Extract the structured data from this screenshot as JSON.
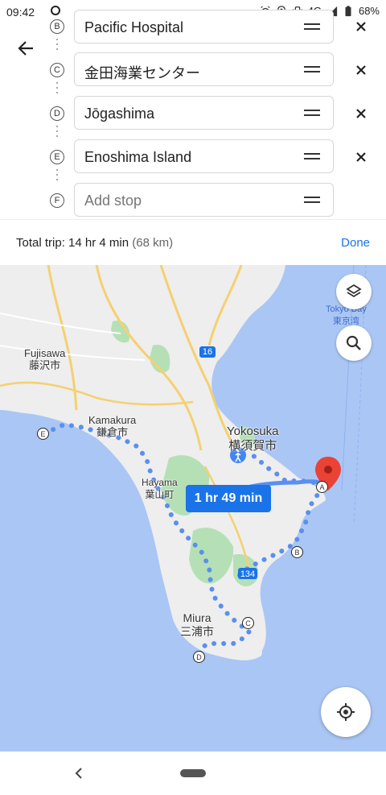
{
  "status_bar": {
    "time": "09:42",
    "network": "4G",
    "battery": "68%"
  },
  "header": {
    "back_icon": "arrow-left-icon",
    "stops": [
      {
        "letter": "B",
        "label": "Pacific Hospital",
        "placeholder": false
      },
      {
        "letter": "C",
        "label": "金田海業センター",
        "placeholder": false
      },
      {
        "letter": "D",
        "label": "Jōgashima",
        "placeholder": false
      },
      {
        "letter": "E",
        "label": "Enoshima Island",
        "placeholder": false
      },
      {
        "letter": "F",
        "label": "Add stop",
        "placeholder": true
      }
    ]
  },
  "trip": {
    "label": "Total trip: 14 hr 4 min",
    "distance": "(68 km)",
    "done": "Done"
  },
  "map": {
    "route_time": "1 hr 49 min",
    "road_shield": "16",
    "road_shield_2": "134",
    "labels": {
      "fujisawa": "Fujisawa",
      "fujisawa_jp": "藤沢市",
      "kamakura": "Kamakura",
      "kamakura_jp": "鎌倉市",
      "yokosuka": "Yokosuka",
      "yokosuka_jp": "横須賀市",
      "hayama": "Hayama",
      "hayama_jp": "葉山町",
      "miura": "Miura",
      "miura_jp": "三浦市",
      "tokyo_bay": "Tokyo Bay",
      "tokyo_bay_jp": "東京湾"
    },
    "markers": {
      "a": "A",
      "b": "B",
      "c": "C",
      "d": "D",
      "e": "E"
    },
    "colors": {
      "water": "#aac6f5",
      "land": "#eeeeee",
      "green": "#b5e0b5",
      "route": "#1a73e8",
      "pin": "#ea4335"
    }
  },
  "nav": {
    "back_icon": "nav-back-icon",
    "home_icon": "nav-home-pill"
  }
}
